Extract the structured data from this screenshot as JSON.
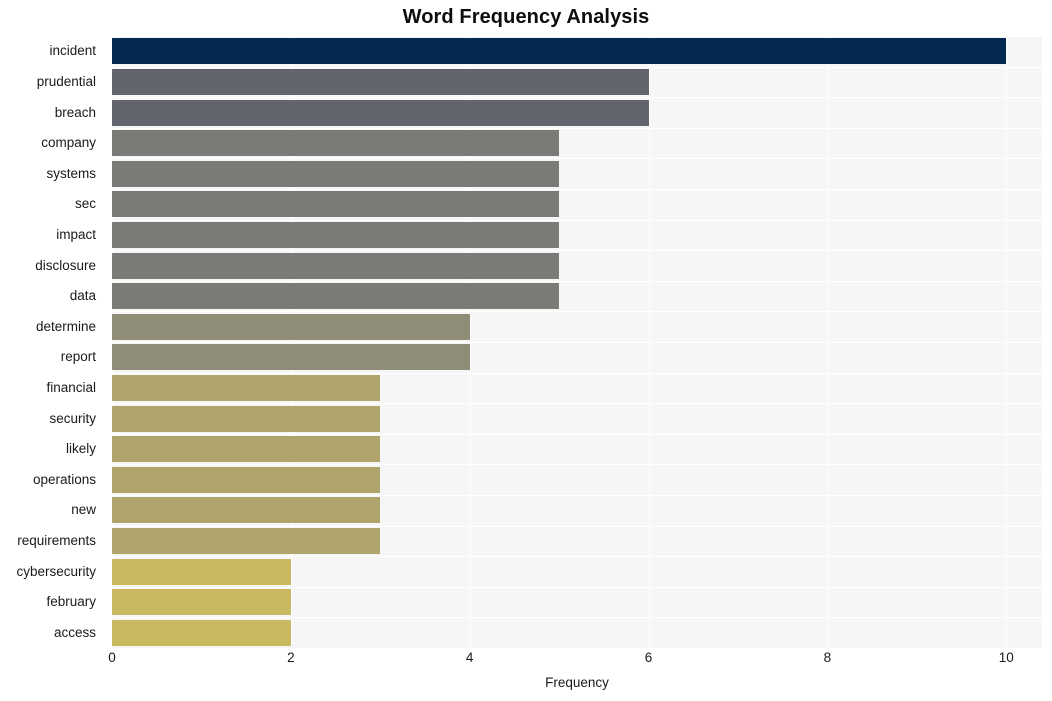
{
  "chart_data": {
    "type": "bar",
    "orientation": "horizontal",
    "title": "Word Frequency Analysis",
    "xlabel": "Frequency",
    "ylabel": "",
    "categories": [
      "incident",
      "prudential",
      "breach",
      "company",
      "systems",
      "sec",
      "impact",
      "disclosure",
      "data",
      "determine",
      "report",
      "financial",
      "security",
      "likely",
      "operations",
      "new",
      "requirements",
      "cybersecurity",
      "february",
      "access"
    ],
    "values": [
      10,
      6,
      6,
      5,
      5,
      5,
      5,
      5,
      5,
      4,
      4,
      3,
      3,
      3,
      3,
      3,
      3,
      2,
      2,
      2
    ],
    "bar_colors": [
      "#042a52",
      "#62656e",
      "#62656e",
      "#7a7a77",
      "#7a7a77",
      "#7a7a77",
      "#7a7a77",
      "#7a7a77",
      "#7a7a77",
      "#8f8c78",
      "#8f8c78",
      "#afa56c",
      "#afa56c",
      "#afa56c",
      "#afa56c",
      "#afa56c",
      "#afa56c",
      "#c9b961",
      "#c9b961",
      "#c9b961"
    ],
    "xticks": [
      0,
      2,
      4,
      6,
      8,
      10
    ],
    "xtick_labels": [
      "0",
      "2",
      "4",
      "6",
      "8",
      "10"
    ],
    "xlim": [
      0,
      10.4
    ],
    "grid": "both",
    "legend": "none",
    "plot_background": "#f6f6f7",
    "figure_background": "#ffffff",
    "gridline_color": "#ffffff"
  }
}
